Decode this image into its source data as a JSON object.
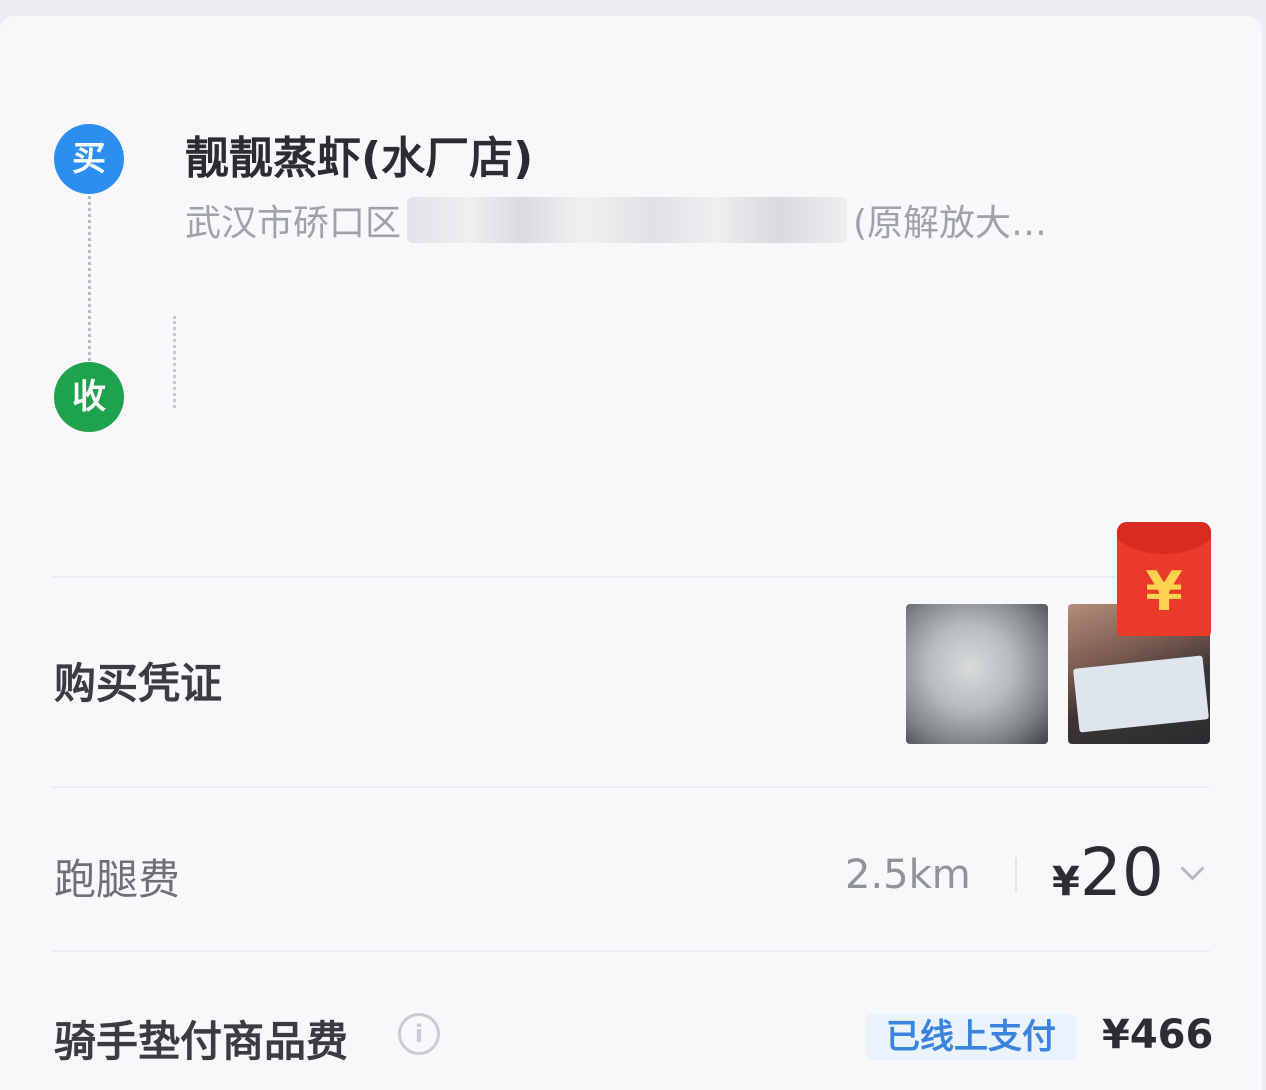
{
  "route": {
    "buy_marker": "买",
    "receive_marker": "收"
  },
  "shop": {
    "name": "靓靓蒸虾(水厂店)",
    "address_prefix": "武汉市硚口区",
    "address_suffix": "(原解放大…"
  },
  "proof": {
    "label": "购买凭证",
    "redpacket_symbol": "¥"
  },
  "delivery_fee": {
    "label": "跑腿费",
    "distance": "2.5km",
    "currency": "¥",
    "amount": "20"
  },
  "goods_fee": {
    "label": "骑手垫付商品费",
    "info_symbol": "i",
    "status": "已线上支付",
    "amount": "¥466"
  },
  "colors": {
    "buy_marker": "#2c8ef0",
    "receive_marker": "#1ea34c",
    "paid_tag_text": "#3a84e0",
    "redpacket": "#ea3a2a"
  }
}
